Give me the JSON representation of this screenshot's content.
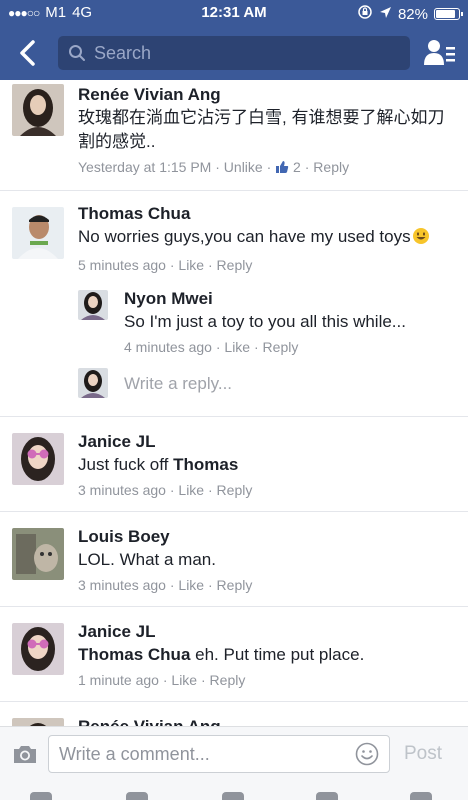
{
  "status_bar": {
    "carrier": "M1",
    "network": "4G",
    "time": "12:31 AM",
    "battery": "82%"
  },
  "search": {
    "placeholder": "Search"
  },
  "comments": [
    {
      "name": "Renée Vivian Ang",
      "text": "玫瑰都在淌血它沾污了白雪, 有谁想要了解心如刀割的感觉..",
      "time": "Yesterday at 1:15 PM",
      "action": "Unlike",
      "likes": "2",
      "reply": "Reply"
    },
    {
      "name": "Thomas Chua",
      "text": "No worries guys,you can have my used toys",
      "time": "5 minutes ago",
      "action": "Like",
      "reply": "Reply",
      "replies": [
        {
          "name": "Nyon Mwei",
          "text": "So I'm just a toy to you all this while...",
          "time": "4 minutes ago",
          "action": "Like",
          "reply": "Reply"
        }
      ],
      "write_reply_placeholder": "Write a reply..."
    },
    {
      "name": "Janice JL",
      "text_prefix": "Just fuck off",
      "text_bold": "Thomas",
      "time": "3 minutes ago",
      "action": "Like",
      "reply": "Reply"
    },
    {
      "name": "Louis Boey",
      "text": "LOL. What a man.",
      "time": "3 minutes ago",
      "action": "Like",
      "reply": "Reply"
    },
    {
      "name": "Janice JL",
      "text_bold": "Thomas Chua",
      "text_suffix": "eh. Put time put place.",
      "time": "1 minute ago",
      "action": "Like",
      "reply": "Reply"
    },
    {
      "name": "Renée Vivian Ang"
    }
  ],
  "composer": {
    "placeholder": "Write a comment...",
    "post_label": "Post"
  },
  "icons": {
    "back": "back-chevron-icon",
    "search": "search-icon",
    "friends": "friend-list-icon",
    "camera": "camera-icon",
    "emoji": "emoji-icon",
    "like": "thumbs-up-icon",
    "location": "location-arrow-icon",
    "rotation_lock": "rotation-lock-icon"
  },
  "colors": {
    "brand": "#3b5998",
    "link": "#4267b2",
    "meta": "#90949c"
  }
}
